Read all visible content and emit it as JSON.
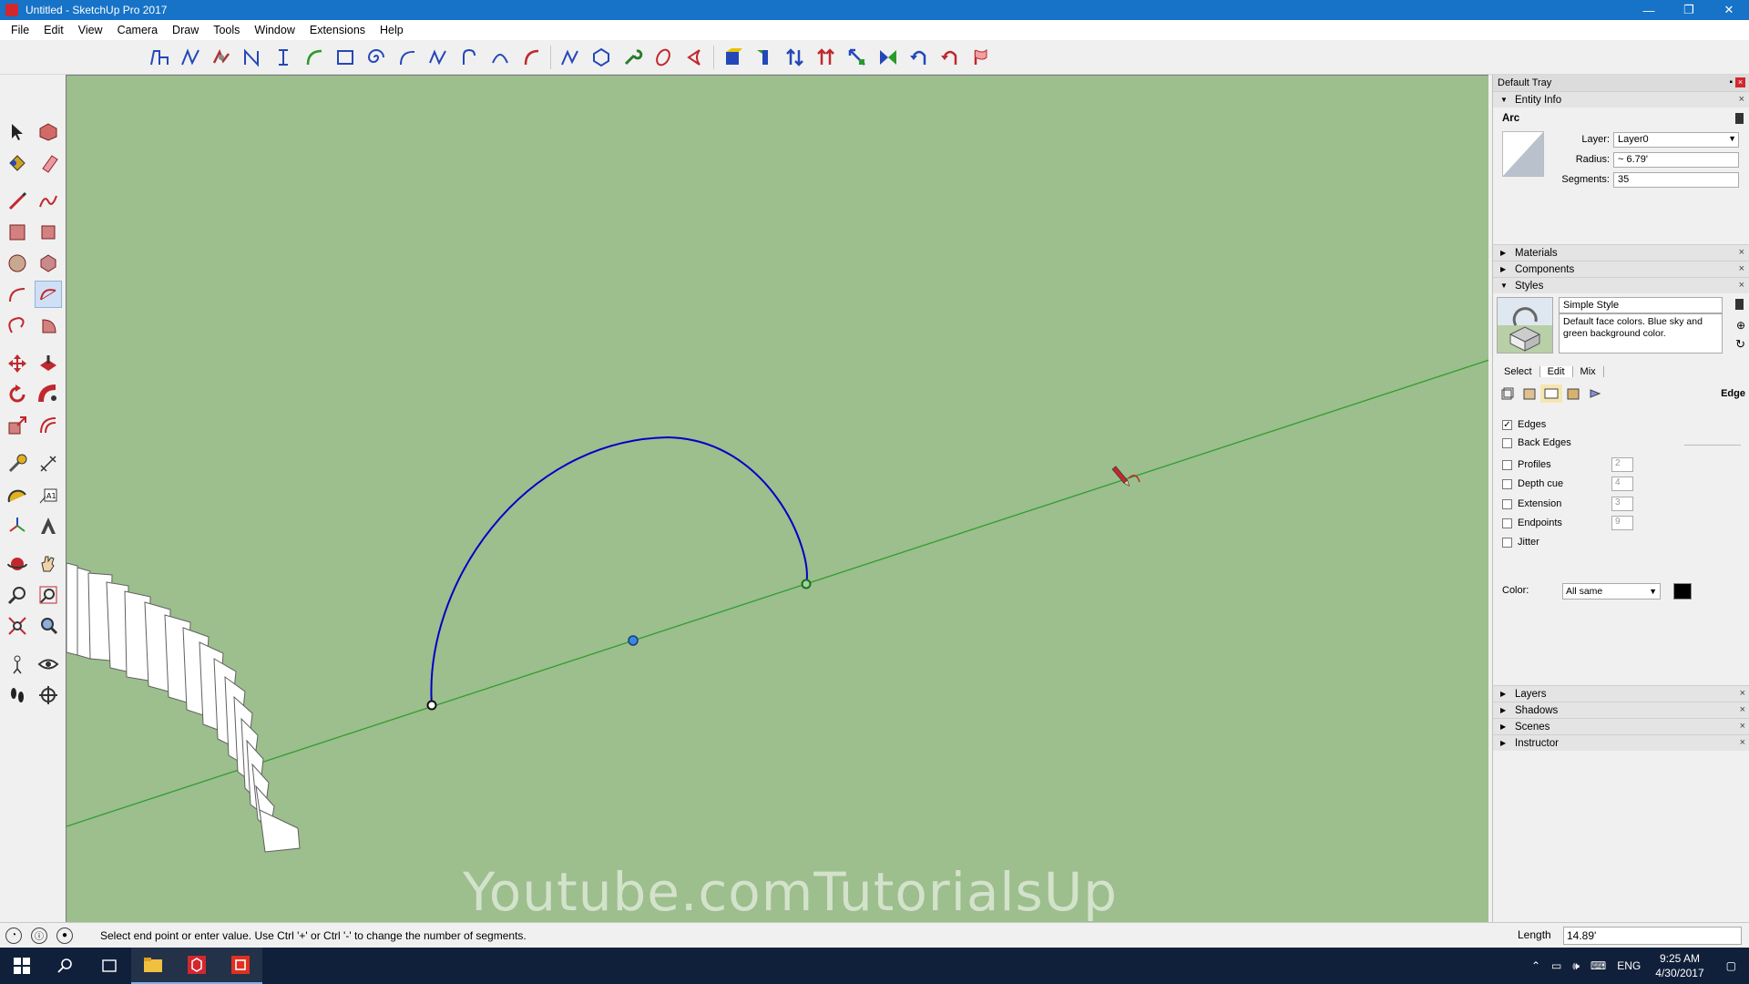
{
  "window": {
    "title": "Untitled - SketchUp Pro 2017",
    "min": "—",
    "restore": "❐",
    "close": "✕"
  },
  "menu": [
    "File",
    "Edit",
    "View",
    "Camera",
    "Draw",
    "Tools",
    "Window",
    "Extensions",
    "Help"
  ],
  "colors": {
    "accent": "#1673c7",
    "viewport_bg": "#9dbe8d",
    "axis_green": "#2f9e2f",
    "arc_blue": "#0000c8",
    "taskbar": "#11203a"
  },
  "tray": {
    "title": "Default Tray",
    "entity_info": {
      "header": "Entity Info",
      "entity_type": "Arc",
      "layer_label": "Layer:",
      "layer_value": "Layer0",
      "radius_label": "Radius:",
      "radius_value": "~ 6.79'",
      "segments_label": "Segments:",
      "segments_value": "35"
    },
    "panels_mid": [
      "Materials",
      "Components"
    ],
    "styles": {
      "header": "Styles",
      "style_name": "Simple Style",
      "style_desc": "Default face colors. Blue sky and green background color.",
      "tabs": [
        "Select",
        "Edit",
        "Mix"
      ],
      "section": "Edge",
      "options": [
        {
          "label": "Edges",
          "checked": true
        },
        {
          "label": "Back Edges",
          "checked": false
        },
        {
          "label": "Profiles",
          "checked": false,
          "value": "2"
        },
        {
          "label": "Depth cue",
          "checked": false,
          "value": "4"
        },
        {
          "label": "Extension",
          "checked": false,
          "value": "3"
        },
        {
          "label": "Endpoints",
          "checked": false,
          "value": "9"
        },
        {
          "label": "Jitter",
          "checked": false
        }
      ],
      "color_label": "Color:",
      "color_value": "All same"
    },
    "panels_bottom": [
      "Layers",
      "Shadows",
      "Scenes",
      "Instructor"
    ]
  },
  "status": {
    "message": "Select end point or enter value. Use Ctrl '+' or Ctrl '-' to change the number of segments.",
    "measure_label": "Length",
    "measure_value": "14.89'"
  },
  "watermark": "Youtube.comTutorialsUp",
  "taskbar": {
    "lang": "ENG",
    "time": "9:25 AM",
    "date": "4/30/2017"
  }
}
